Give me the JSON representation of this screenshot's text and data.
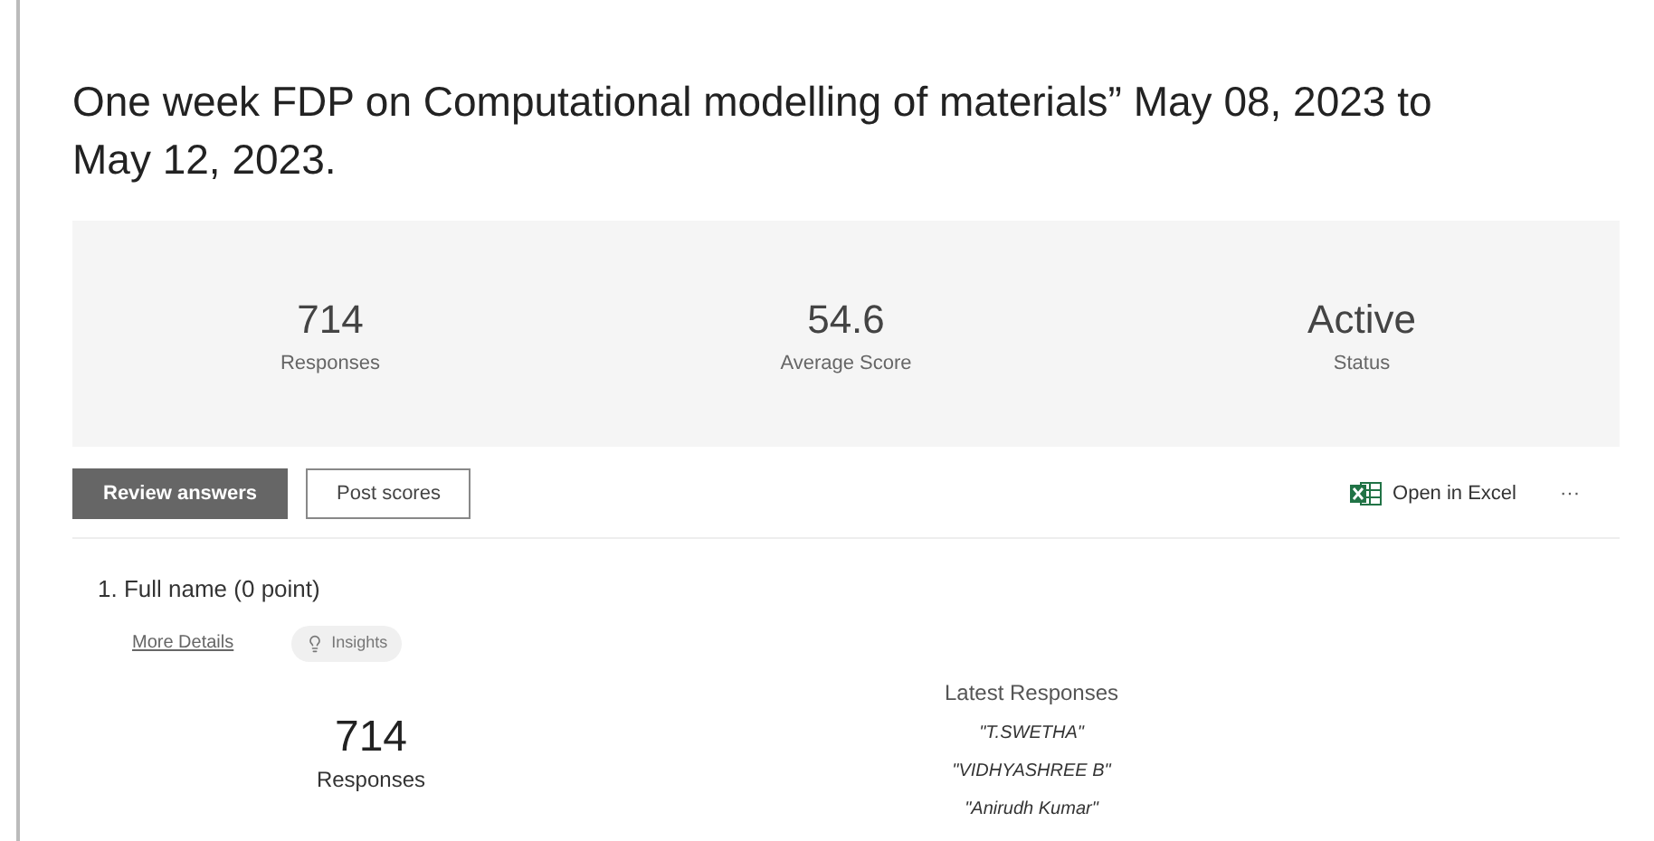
{
  "title": "One week FDP on Computational modelling of materials” May 08, 2023 to May 12, 2023.",
  "summary": [
    {
      "value": "714",
      "label": "Responses"
    },
    {
      "value": "54.6",
      "label": "Average Score"
    },
    {
      "value": "Active",
      "label": "Status"
    }
  ],
  "view_tabs": [
    {
      "label": "Review answers",
      "selected": true
    },
    {
      "label": "Post scores",
      "selected": false
    }
  ],
  "open_in_excel": "Open in Excel",
  "more_menu": "···",
  "question": {
    "title": "1. Full name (0 point)",
    "more_details": "More Details",
    "insights": "Insights",
    "count": "714",
    "count_label": "Responses",
    "latest_heading": "Latest Responses",
    "latest": [
      "\"T.SWETHA\"",
      "\"VIDHYASHREE B\"",
      "\"Anirudh Kumar\""
    ]
  }
}
